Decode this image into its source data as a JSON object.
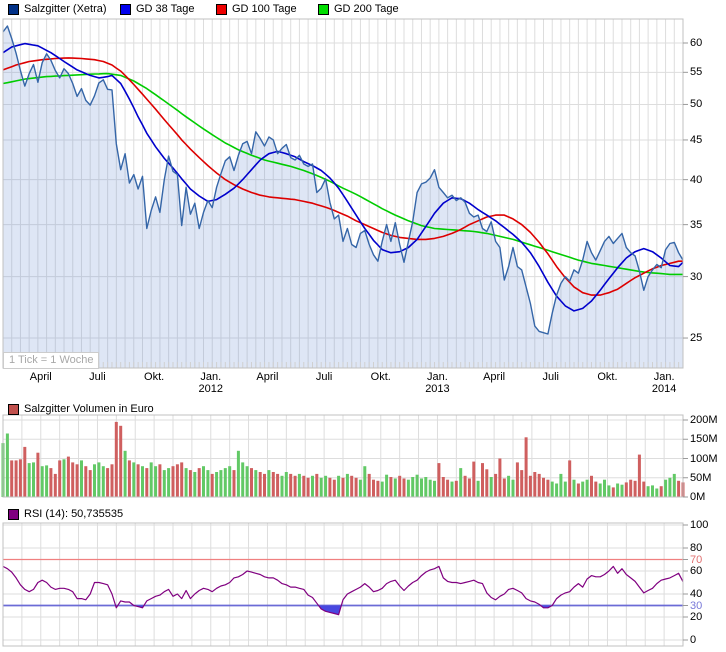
{
  "legend_main": {
    "items": [
      {
        "label": "Salzgitter (Xetra)",
        "color": "#003087"
      },
      {
        "label": "GD 38 Tage",
        "color": "#0000ee"
      },
      {
        "label": "GD 100 Tage",
        "color": "#ee0000"
      },
      {
        "label": "GD 200 Tage",
        "color": "#00dd00"
      }
    ]
  },
  "volume_legend": {
    "label": "Salzgitter Volumen in Euro",
    "color": "#c0504d"
  },
  "rsi_legend": {
    "label": "RSI (14): 50,735535",
    "color": "#800080"
  },
  "tick_note": "1 Tick = 1 Woche",
  "colors": {
    "grid": "#dddddd",
    "frame": "#c0c0c0",
    "axis_tick": "#999999",
    "price_line": "#3566a8",
    "price_fill": "rgba(105,140,210,0.22)",
    "gd38": "#0000cc",
    "gd100": "#dd0000",
    "gd200": "#00cc00",
    "vol_up": "#62c966",
    "vol_down": "#cf5f5f",
    "rsi_line": "#800080",
    "rsi_over_line": "#f08080",
    "rsi_under_line": "#6b6bd6",
    "rsi_under_fill": "#4848e0",
    "rsi_over_label": "#e07070",
    "rsi_under_label": "#7878d8",
    "week_tick": "#d0d0d0"
  },
  "x_axis": {
    "labels": [
      {
        "text": "April",
        "month": 2,
        "year": ""
      },
      {
        "text": "Juli",
        "month": 5,
        "year": ""
      },
      {
        "text": "Okt.",
        "month": 8,
        "year": ""
      },
      {
        "text": "Jan.",
        "month": 11,
        "year": "2012"
      },
      {
        "text": "April",
        "month": 14,
        "year": ""
      },
      {
        "text": "Juli",
        "month": 17,
        "year": ""
      },
      {
        "text": "Okt.",
        "month": 20,
        "year": ""
      },
      {
        "text": "Jan.",
        "month": 23,
        "year": "2013"
      },
      {
        "text": "April",
        "month": 26,
        "year": ""
      },
      {
        "text": "Juli",
        "month": 29,
        "year": ""
      },
      {
        "text": "Okt.",
        "month": 32,
        "year": ""
      },
      {
        "text": "Jan.",
        "month": 35,
        "year": "2014"
      }
    ],
    "months_total": 36
  },
  "chart_data": {
    "type": "line",
    "title": "Salzgitter (Xetra)",
    "x_unit": "1 Tick = 1 Woche",
    "price_axis": {
      "ticks": [
        60,
        55,
        50,
        45,
        40,
        35,
        30,
        25
      ],
      "scale": "log"
    },
    "volume_axis": {
      "ticks": [
        {
          "label": "200M",
          "value": 200
        },
        {
          "label": "150M",
          "value": 150
        },
        {
          "label": "100M",
          "value": 100
        },
        {
          "label": "50M",
          "value": 50
        },
        {
          "label": "0M",
          "value": 0
        }
      ]
    },
    "rsi_axis": {
      "ticks": [
        100,
        80,
        70,
        60,
        40,
        30,
        20,
        0
      ],
      "overbought": 70,
      "oversold": 30,
      "last_value": 50.735535
    },
    "weeks": 157,
    "price": [
      62.0,
      63.1,
      60.8,
      58.2,
      55.3,
      52.8,
      54.8,
      56.3,
      53.4,
      56.6,
      58.1,
      57.0,
      55.3,
      54.1,
      55.6,
      54.8,
      53.2,
      51.2,
      52.4,
      50.6,
      49.9,
      51.3,
      53.3,
      53.8,
      52.3,
      52.2,
      44.5,
      41.2,
      43.2,
      39.6,
      40.6,
      38.9,
      40.4,
      34.6,
      36.5,
      38.0,
      36.3,
      40.0,
      42.9,
      41.0,
      40.6,
      34.9,
      39.1,
      36.1,
      37.3,
      34.6,
      36.3,
      37.6,
      36.8,
      39.1,
      40.7,
      42.3,
      42.8,
      41.1,
      43.0,
      44.5,
      44.8,
      43.2,
      46.1,
      45.2,
      44.2,
      45.4,
      45.0,
      43.2,
      43.9,
      44.4,
      42.7,
      42.4,
      43.0,
      41.9,
      41.6,
      41.9,
      38.5,
      39.0,
      40.1,
      37.4,
      35.6,
      36.0,
      33.3,
      34.6,
      33.0,
      32.7,
      34.1,
      34.4,
      33.0,
      32.0,
      31.4,
      33.3,
      35.0,
      33.3,
      35.2,
      33.0,
      31.3,
      33.3,
      35.3,
      38.5,
      39.5,
      39.7,
      40.2,
      41.2,
      39.1,
      38.5,
      37.9,
      38.2,
      37.6,
      37.9,
      37.4,
      36.2,
      35.8,
      36.0,
      34.6,
      34.3,
      35.3,
      33.3,
      32.7,
      29.7,
      30.9,
      32.7,
      30.9,
      30.6,
      29.1,
      27.7,
      25.9,
      25.5,
      25.4,
      25.3,
      26.9,
      28.4,
      29.4,
      30.0,
      29.6,
      30.6,
      30.3,
      31.5,
      33.3,
      32.2,
      31.5,
      32.4,
      33.3,
      33.8,
      33.1,
      33.6,
      34.1,
      32.7,
      32.2,
      31.9,
      30.5,
      28.8,
      30.0,
      30.6,
      31.1,
      30.8,
      32.5,
      33.1,
      33.2,
      32.2,
      31.5
    ],
    "volume_millions": [
      140,
      165,
      95,
      95,
      98,
      130,
      88,
      90,
      115,
      80,
      82,
      75,
      60,
      95,
      98,
      105,
      90,
      85,
      95,
      80,
      70,
      85,
      90,
      80,
      75,
      85,
      195,
      185,
      120,
      95,
      90,
      85,
      80,
      75,
      90,
      80,
      85,
      70,
      75,
      80,
      85,
      90,
      75,
      70,
      65,
      75,
      80,
      70,
      60,
      65,
      70,
      75,
      80,
      70,
      120,
      90,
      80,
      75,
      70,
      65,
      60,
      70,
      65,
      60,
      55,
      65,
      60,
      55,
      60,
      55,
      50,
      55,
      60,
      50,
      55,
      50,
      45,
      55,
      50,
      60,
      55,
      50,
      45,
      80,
      60,
      45,
      42,
      40,
      58,
      52,
      48,
      55,
      48,
      45,
      52,
      58,
      48,
      52,
      45,
      42,
      88,
      52,
      45,
      40,
      42,
      75,
      55,
      48,
      92,
      42,
      88,
      72,
      52,
      60,
      100,
      48,
      55,
      45,
      90,
      70,
      155,
      55,
      65,
      60,
      50,
      45,
      40,
      35,
      60,
      40,
      95,
      45,
      35,
      40,
      45,
      55,
      40,
      35,
      45,
      30,
      25,
      35,
      32,
      38,
      45,
      42,
      110,
      40,
      28,
      30,
      22,
      28,
      45,
      50,
      60,
      42,
      38
    ],
    "rsi": [
      64,
      62,
      59,
      54,
      48,
      44,
      42,
      44,
      50,
      52,
      50,
      46,
      44,
      45,
      45,
      44,
      42,
      36,
      36,
      35,
      40,
      50,
      50,
      49,
      48,
      40,
      28,
      34,
      33,
      33,
      30,
      29,
      28,
      34,
      36,
      38,
      39,
      42,
      44,
      38,
      40,
      36,
      43,
      36,
      40,
      43,
      45,
      44,
      42,
      45,
      47,
      48,
      50,
      54,
      55,
      57,
      60,
      59,
      58,
      57,
      55,
      54,
      54,
      52,
      49,
      48,
      46,
      46,
      45,
      44,
      39,
      37,
      32,
      27,
      25,
      24,
      23,
      22,
      35,
      40,
      42,
      44,
      46,
      49,
      46,
      42,
      43,
      45,
      49,
      51,
      52,
      47,
      43,
      47,
      50,
      52,
      56,
      59,
      61,
      62,
      64,
      54,
      51,
      50,
      50,
      49,
      50,
      51,
      52,
      50,
      49,
      41,
      37,
      35,
      38,
      40,
      44,
      45,
      43,
      41,
      36,
      34,
      33,
      31,
      28,
      28,
      30,
      36,
      39,
      41,
      42,
      46,
      49,
      46,
      53,
      56,
      55,
      55,
      57,
      60,
      64,
      58,
      62,
      57,
      54,
      51,
      46,
      41,
      43,
      45,
      49,
      52,
      53,
      54,
      56,
      58,
      50.7
    ],
    "gd38_keypoints": [
      [
        0,
        58.3
      ],
      [
        2,
        59.3
      ],
      [
        5,
        59.9
      ],
      [
        8,
        59.5
      ],
      [
        11,
        58.3
      ],
      [
        14,
        56.8
      ],
      [
        17,
        55.4
      ],
      [
        20,
        54.5
      ],
      [
        22,
        54.1
      ],
      [
        24,
        54.3
      ],
      [
        25,
        54.5
      ],
      [
        27,
        53.2
      ],
      [
        29,
        50.8
      ],
      [
        31,
        48.2
      ],
      [
        33,
        45.9
      ],
      [
        35,
        44.1
      ],
      [
        37,
        42.6
      ],
      [
        39,
        41.4
      ],
      [
        41,
        40.1
      ],
      [
        43,
        38.9
      ],
      [
        45,
        38.1
      ],
      [
        47,
        37.5
      ],
      [
        49,
        37.7
      ],
      [
        51,
        38.3
      ],
      [
        53,
        39.0
      ],
      [
        55,
        40.0
      ],
      [
        57,
        41.2
      ],
      [
        59,
        42.4
      ],
      [
        61,
        43.2
      ],
      [
        63,
        43.5
      ],
      [
        65,
        43.2
      ],
      [
        67,
        42.8
      ],
      [
        69,
        42.2
      ],
      [
        71,
        41.7
      ],
      [
        73,
        41.1
      ],
      [
        75,
        40.2
      ],
      [
        77,
        39.0
      ],
      [
        79,
        37.5
      ],
      [
        81,
        36.0
      ],
      [
        83,
        34.6
      ],
      [
        85,
        33.4
      ],
      [
        87,
        32.5
      ],
      [
        89,
        32.2
      ],
      [
        91,
        32.3
      ],
      [
        93,
        32.7
      ],
      [
        95,
        33.5
      ],
      [
        97,
        34.8
      ],
      [
        99,
        36.2
      ],
      [
        101,
        37.3
      ],
      [
        103,
        37.9
      ],
      [
        105,
        37.8
      ],
      [
        107,
        37.3
      ],
      [
        109,
        36.6
      ],
      [
        111,
        36.0
      ],
      [
        113,
        35.4
      ],
      [
        115,
        34.7
      ],
      [
        117,
        34.0
      ],
      [
        119,
        33.2
      ],
      [
        121,
        32.2
      ],
      [
        123,
        30.9
      ],
      [
        125,
        29.5
      ],
      [
        127,
        28.3
      ],
      [
        129,
        27.5
      ],
      [
        131,
        27.1
      ],
      [
        133,
        27.3
      ],
      [
        135,
        27.9
      ],
      [
        137,
        28.8
      ],
      [
        139,
        29.8
      ],
      [
        141,
        30.8
      ],
      [
        143,
        31.7
      ],
      [
        145,
        32.3
      ],
      [
        147,
        32.6
      ],
      [
        149,
        32.3
      ],
      [
        151,
        31.7
      ],
      [
        153,
        31.0
      ],
      [
        155,
        30.9
      ],
      [
        156,
        31.3
      ]
    ],
    "gd100_keypoints": [
      [
        0,
        55.4
      ],
      [
        3,
        56.2
      ],
      [
        6,
        56.8
      ],
      [
        9,
        57.1
      ],
      [
        12,
        57.3
      ],
      [
        15,
        57.4
      ],
      [
        18,
        57.3
      ],
      [
        21,
        57.1
      ],
      [
        23,
        56.8
      ],
      [
        25,
        56.2
      ],
      [
        27,
        55.2
      ],
      [
        29,
        53.8
      ],
      [
        31,
        52.3
      ],
      [
        33,
        50.8
      ],
      [
        35,
        49.3
      ],
      [
        37,
        47.8
      ],
      [
        39,
        46.4
      ],
      [
        41,
        45.0
      ],
      [
        43,
        43.8
      ],
      [
        45,
        42.7
      ],
      [
        47,
        41.7
      ],
      [
        49,
        40.8
      ],
      [
        51,
        40.0
      ],
      [
        53,
        39.4
      ],
      [
        55,
        38.9
      ],
      [
        57,
        38.5
      ],
      [
        59,
        38.2
      ],
      [
        61,
        38.0
      ],
      [
        63,
        37.9
      ],
      [
        65,
        37.8
      ],
      [
        67,
        37.7
      ],
      [
        69,
        37.5
      ],
      [
        71,
        37.3
      ],
      [
        73,
        37.0
      ],
      [
        75,
        36.7
      ],
      [
        77,
        36.3
      ],
      [
        79,
        35.9
      ],
      [
        81,
        35.4
      ],
      [
        83,
        35.0
      ],
      [
        85,
        34.6
      ],
      [
        87,
        34.2
      ],
      [
        89,
        33.9
      ],
      [
        91,
        33.7
      ],
      [
        93,
        33.6
      ],
      [
        95,
        33.5
      ],
      [
        97,
        33.5
      ],
      [
        99,
        33.6
      ],
      [
        101,
        33.8
      ],
      [
        103,
        34.1
      ],
      [
        105,
        34.5
      ],
      [
        107,
        35.0
      ],
      [
        109,
        35.4
      ],
      [
        111,
        35.8
      ],
      [
        113,
        36.0
      ],
      [
        115,
        36.0
      ],
      [
        117,
        35.6
      ],
      [
        119,
        35.0
      ],
      [
        121,
        34.2
      ],
      [
        123,
        33.2
      ],
      [
        125,
        32.1
      ],
      [
        127,
        30.9
      ],
      [
        129,
        29.9
      ],
      [
        131,
        29.1
      ],
      [
        133,
        28.6
      ],
      [
        135,
        28.4
      ],
      [
        137,
        28.4
      ],
      [
        139,
        28.6
      ],
      [
        141,
        28.9
      ],
      [
        143,
        29.4
      ],
      [
        145,
        29.9
      ],
      [
        147,
        30.3
      ],
      [
        149,
        30.7
      ],
      [
        151,
        31.0
      ],
      [
        153,
        31.2
      ],
      [
        155,
        31.4
      ],
      [
        156,
        31.4
      ]
    ],
    "gd200_keypoints": [
      [
        0,
        53.2
      ],
      [
        5,
        53.9
      ],
      [
        10,
        54.3
      ],
      [
        15,
        54.5
      ],
      [
        20,
        54.7
      ],
      [
        24,
        54.8
      ],
      [
        27,
        54.5
      ],
      [
        30,
        53.6
      ],
      [
        33,
        52.4
      ],
      [
        36,
        51.0
      ],
      [
        39,
        49.6
      ],
      [
        42,
        48.2
      ],
      [
        45,
        46.9
      ],
      [
        48,
        45.7
      ],
      [
        51,
        44.6
      ],
      [
        54,
        43.7
      ],
      [
        57,
        43.0
      ],
      [
        60,
        42.4
      ],
      [
        63,
        42.0
      ],
      [
        66,
        41.6
      ],
      [
        69,
        41.1
      ],
      [
        72,
        40.5
      ],
      [
        75,
        39.8
      ],
      [
        78,
        39.0
      ],
      [
        81,
        38.3
      ],
      [
        84,
        37.5
      ],
      [
        87,
        36.7
      ],
      [
        90,
        36.0
      ],
      [
        93,
        35.4
      ],
      [
        96,
        34.9
      ],
      [
        99,
        34.6
      ],
      [
        102,
        34.5
      ],
      [
        105,
        34.4
      ],
      [
        108,
        34.3
      ],
      [
        111,
        34.1
      ],
      [
        114,
        33.8
      ],
      [
        117,
        33.5
      ],
      [
        120,
        33.1
      ],
      [
        123,
        32.7
      ],
      [
        126,
        32.3
      ],
      [
        129,
        31.9
      ],
      [
        132,
        31.5
      ],
      [
        135,
        31.2
      ],
      [
        138,
        31.0
      ],
      [
        141,
        30.8
      ],
      [
        144,
        30.6
      ],
      [
        147,
        30.4
      ],
      [
        150,
        30.3
      ],
      [
        153,
        30.2
      ],
      [
        156,
        30.2
      ]
    ]
  }
}
